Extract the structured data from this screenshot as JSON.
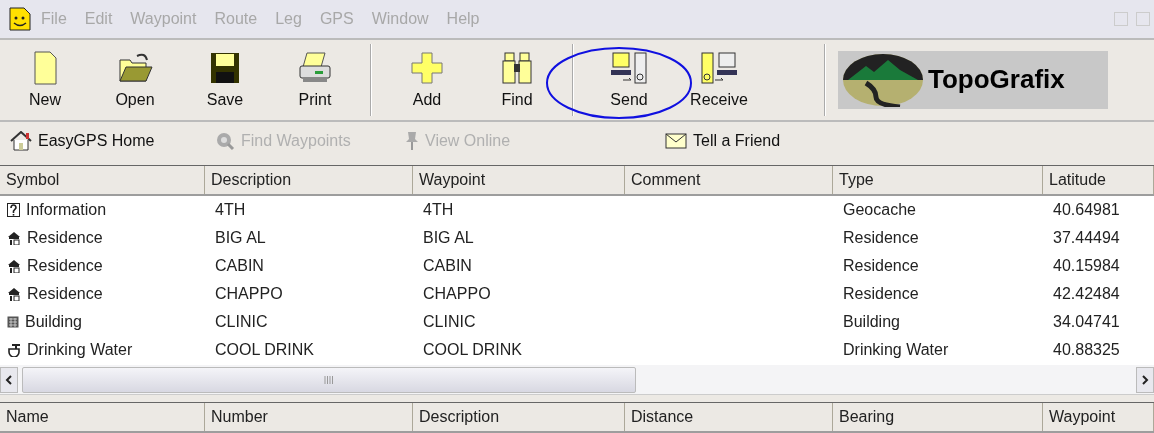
{
  "menu": [
    "File",
    "Edit",
    "Waypoint",
    "Route",
    "Leg",
    "GPS",
    "Window",
    "Help"
  ],
  "toolbar": [
    {
      "label": "New",
      "kind": "new"
    },
    {
      "label": "Open",
      "kind": "open"
    },
    {
      "label": "Save",
      "kind": "save"
    },
    {
      "label": "Print",
      "kind": "print"
    },
    {
      "label": "Add",
      "kind": "add"
    },
    {
      "label": "Find",
      "kind": "find"
    },
    {
      "label": "Send",
      "kind": "send"
    },
    {
      "label": "Receive",
      "kind": "receive"
    }
  ],
  "logo": {
    "text": "TopoGrafix"
  },
  "links": [
    {
      "label": "EasyGPS Home",
      "kind": "home",
      "disabled": false
    },
    {
      "label": "Find Waypoints",
      "kind": "search",
      "disabled": true
    },
    {
      "label": "View Online",
      "kind": "pin",
      "disabled": true
    },
    {
      "label": "Tell a Friend",
      "kind": "mail",
      "disabled": false
    }
  ],
  "waypoints_table": {
    "columns": [
      "Symbol",
      "Description",
      "Waypoint",
      "Comment",
      "Type",
      "Latitude"
    ],
    "rows": [
      {
        "symbol": "Information",
        "kind": "info",
        "description": "4TH",
        "waypoint": "4TH",
        "type": "Geocache",
        "latitude": "40.64981"
      },
      {
        "symbol": "Residence",
        "kind": "residence",
        "description": "BIG AL",
        "waypoint": "BIG AL",
        "type": "Residence",
        "latitude": "37.44494"
      },
      {
        "symbol": "Residence",
        "kind": "residence",
        "description": "CABIN",
        "waypoint": "CABIN",
        "type": "Residence",
        "latitude": "40.15984"
      },
      {
        "symbol": "Residence",
        "kind": "residence",
        "description": "CHAPPO",
        "waypoint": "CHAPPO",
        "type": "Residence",
        "latitude": "42.42484"
      },
      {
        "symbol": "Building",
        "kind": "building",
        "description": "CLINIC",
        "waypoint": "CLINIC",
        "type": "Building",
        "latitude": "34.04741"
      },
      {
        "symbol": "Drinking Water",
        "kind": "water",
        "description": "COOL DRINK",
        "waypoint": "COOL DRINK",
        "type": "Drinking Water",
        "latitude": "40.88325"
      }
    ]
  },
  "routes_table": {
    "columns": [
      "Name",
      "Number",
      "Description",
      "Distance",
      "Bearing",
      "Waypoint"
    ]
  }
}
